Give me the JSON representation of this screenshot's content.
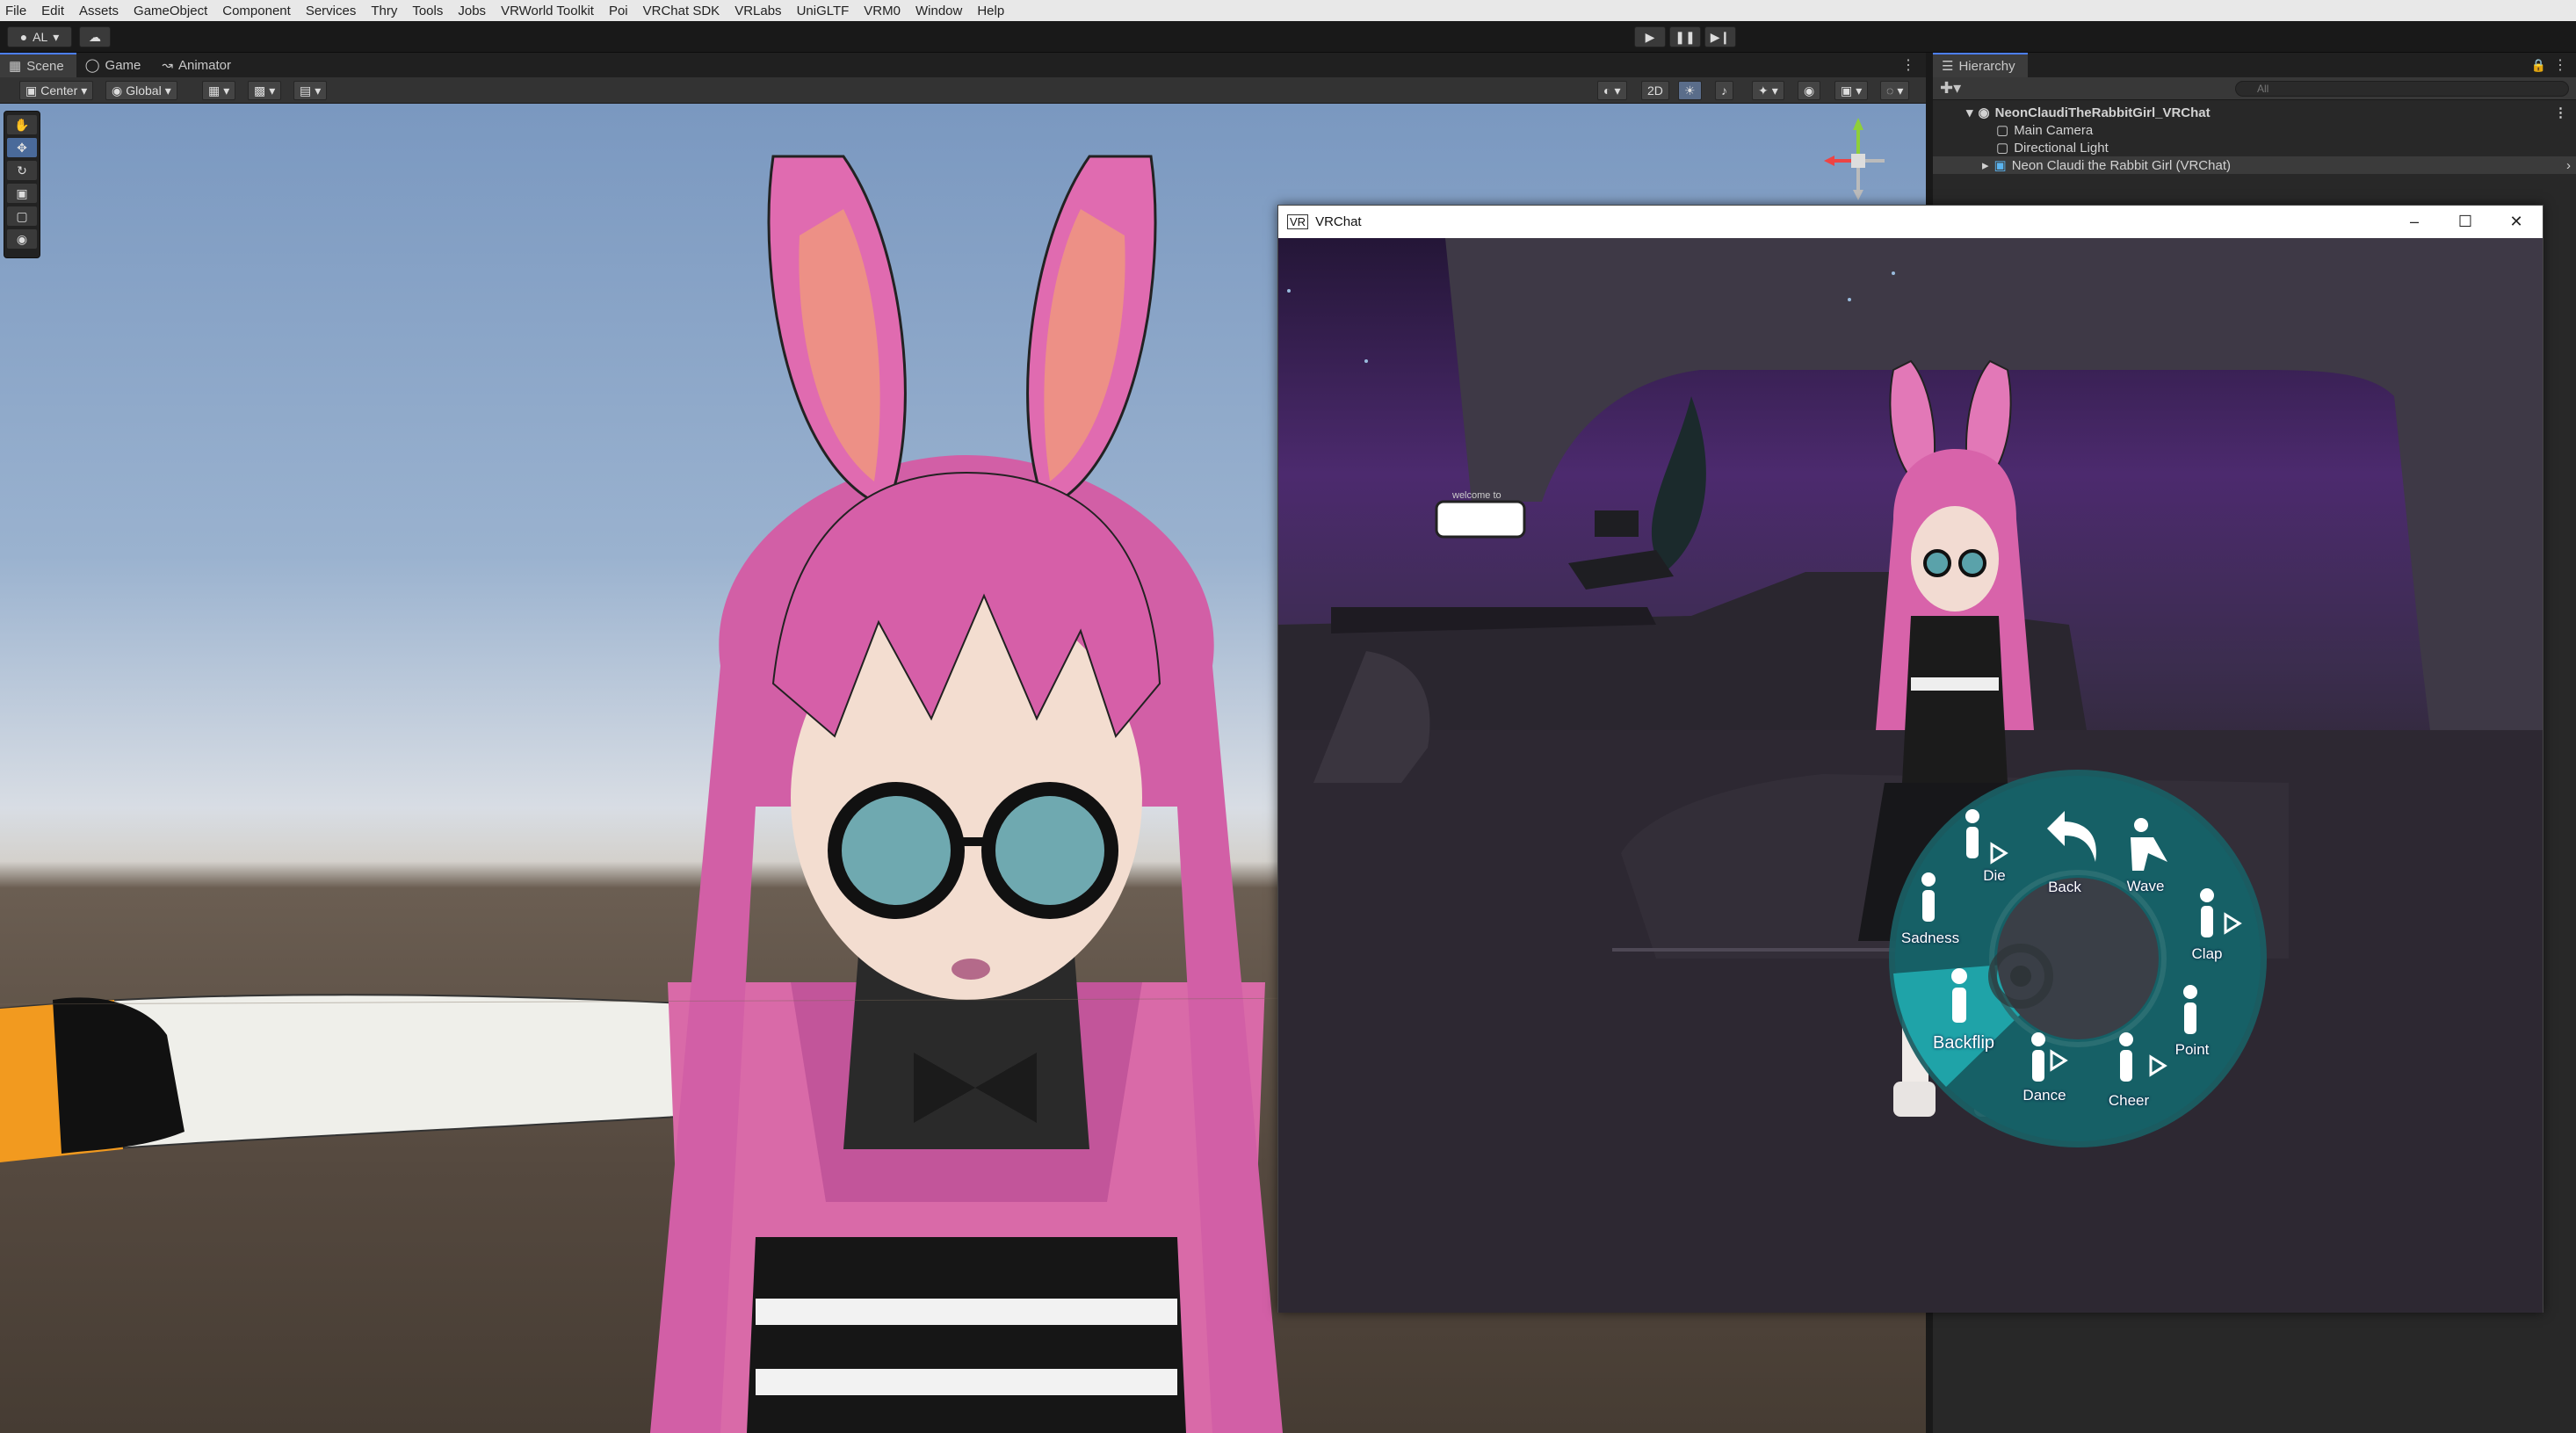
{
  "menubar": {
    "items": [
      "File",
      "Edit",
      "Assets",
      "GameObject",
      "Component",
      "Services",
      "Thry",
      "Tools",
      "Jobs",
      "VRWorld Toolkit",
      "Poi",
      "VRChat SDK",
      "VRLabs",
      "UniGLTF",
      "VRM0",
      "Window",
      "Help"
    ]
  },
  "toolbar": {
    "account_label": "AL",
    "play_icon": "play-icon",
    "pause_icon": "pause-icon",
    "step_icon": "step-icon"
  },
  "scene": {
    "tabs": [
      {
        "label": "Scene",
        "icon": "scene-grid-icon"
      },
      {
        "label": "Game",
        "icon": "gamepad-icon"
      },
      {
        "label": "Animator",
        "icon": "animator-icon"
      }
    ],
    "pivot_mode": "Center",
    "pivot_rotation": "Global",
    "view_2d_label": "2D"
  },
  "hierarchy": {
    "tab_label": "Hierarchy",
    "search_placeholder": "All",
    "root": "NeonClaudiTheRabbitGirl_VRChat",
    "children": [
      "Main Camera",
      "Directional Light",
      "Neon Claudi the Rabbit Girl (VRChat)"
    ]
  },
  "vrchat_window": {
    "title": "VRChat",
    "sign_text": "welcome to",
    "action_menu": {
      "items": [
        {
          "label": "Back",
          "icon": "back-arrow-icon"
        },
        {
          "label": "Wave",
          "icon": "wave-icon"
        },
        {
          "label": "Clap",
          "icon": "clap-icon"
        },
        {
          "label": "Point",
          "icon": "point-icon"
        },
        {
          "label": "Cheer",
          "icon": "cheer-icon"
        },
        {
          "label": "Dance",
          "icon": "dance-icon"
        },
        {
          "label": "Backflip",
          "icon": "backflip-icon"
        },
        {
          "label": "Sadness",
          "icon": "sadness-icon"
        },
        {
          "label": "Die",
          "icon": "die-icon"
        }
      ],
      "selected": "Backflip",
      "accent_color": "#1fa3a8",
      "ring_color": "#1a6e73"
    }
  }
}
